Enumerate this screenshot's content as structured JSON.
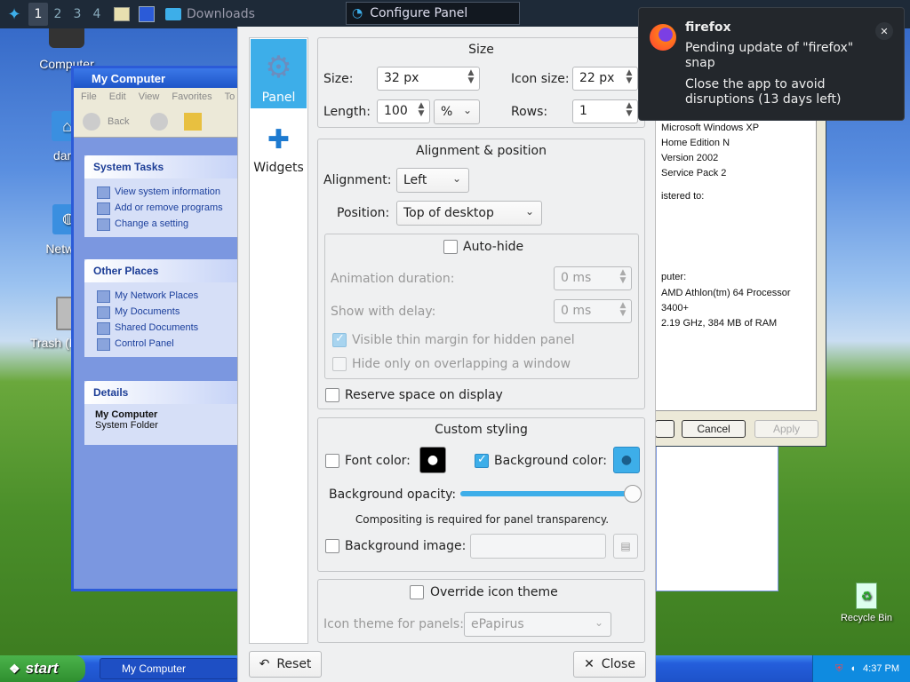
{
  "top_panel": {
    "workspaces": [
      "1",
      "2",
      "3",
      "4"
    ],
    "task_label": "Downloads",
    "active_window_title": "Configure Panel"
  },
  "desktop": {
    "icons": [
      "Computer",
      "dartz",
      "Network",
      "Trash (Empty)",
      "Recycle Bin"
    ]
  },
  "xp_window": {
    "title": "My Computer",
    "menu": [
      "File",
      "Edit",
      "View",
      "Favorites",
      "To"
    ],
    "back_label": "Back",
    "system_tasks": {
      "title": "System Tasks",
      "items": [
        "View system information",
        "Add or remove programs",
        "Change a setting"
      ]
    },
    "other_places": {
      "title": "Other Places",
      "items": [
        "My Network Places",
        "My Documents",
        "Shared Documents",
        "Control Panel"
      ]
    },
    "details": {
      "title": "Details",
      "name": "My Computer",
      "type": "System Folder"
    }
  },
  "sysprops": {
    "lines": [
      "Microsoft Windows XP",
      "Home Edition N",
      "Version 2002",
      "Service Pack 2",
      "istered to:",
      "puter:",
      "AMD Athlon(tm) 64 Processor",
      "3400+",
      "2.19 GHz, 384 MB of RAM"
    ],
    "cancel": "Cancel",
    "apply": "Apply"
  },
  "taskbar": {
    "start": "start",
    "task": "My Computer",
    "clock": "4:37 PM"
  },
  "dialog": {
    "tabs": [
      "Panel",
      "Widgets"
    ],
    "size": {
      "title": "Size",
      "size_label": "Size:",
      "size_value": "32 px",
      "icon_size_label": "Icon size:",
      "icon_size_value": "22 px",
      "length_label": "Length:",
      "length_value": "100",
      "length_unit": "%",
      "rows_label": "Rows:",
      "rows_value": "1"
    },
    "alignment": {
      "title": "Alignment & position",
      "alignment_label": "Alignment:",
      "alignment_value": "Left",
      "position_label": "Position:",
      "position_value": "Top of desktop",
      "autohide_label": "Auto-hide",
      "anim_label": "Animation duration:",
      "anim_value": "0 ms",
      "delay_label": "Show with delay:",
      "delay_value": "0 ms",
      "thin_margin_label": "Visible thin margin for hidden panel",
      "overlap_label": "Hide only on overlapping a window",
      "reserve_label": "Reserve space on display"
    },
    "styling": {
      "title": "Custom styling",
      "font_color_label": "Font color:",
      "bg_color_label": "Background color:",
      "font_color": "#000000",
      "bg_color": "#3daee9",
      "opacity_label": "Background opacity:",
      "opacity": 1.0,
      "compositing_note": "Compositing is required for panel transparency.",
      "bg_image_label": "Background image:"
    },
    "icon_theme": {
      "override_label": "Override icon theme",
      "theme_label": "Icon theme for panels:",
      "theme_value": "ePapirus"
    },
    "reset": "Reset",
    "close": "Close"
  },
  "notification": {
    "app": "firefox",
    "line1": "Pending update of \"firefox\" snap",
    "line2": "Close the app to avoid disruptions (13 days left)"
  }
}
